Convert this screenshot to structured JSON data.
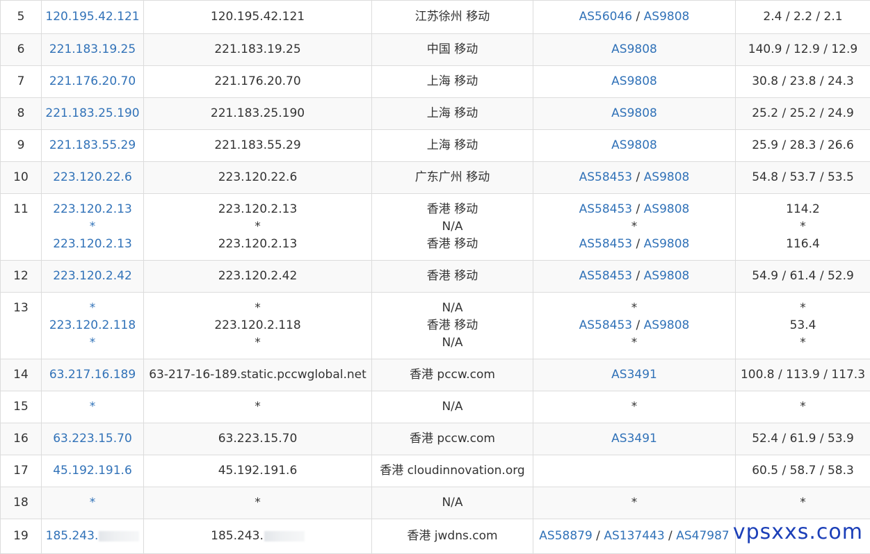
{
  "rows": [
    {
      "hop": "5",
      "ip": [
        "120.195.42.121"
      ],
      "host": [
        "120.195.42.121"
      ],
      "loc": [
        "江苏徐州 移动"
      ],
      "asn": [
        [
          "AS56046",
          "AS9808"
        ]
      ],
      "rtt": [
        "2.4 / 2.2 / 2.1"
      ]
    },
    {
      "hop": "6",
      "ip": [
        "221.183.19.25"
      ],
      "host": [
        "221.183.19.25"
      ],
      "loc": [
        "中国 移动"
      ],
      "asn": [
        [
          "AS9808"
        ]
      ],
      "rtt": [
        "140.9 / 12.9 / 12.9"
      ]
    },
    {
      "hop": "7",
      "ip": [
        "221.176.20.70"
      ],
      "host": [
        "221.176.20.70"
      ],
      "loc": [
        "上海 移动"
      ],
      "asn": [
        [
          "AS9808"
        ]
      ],
      "rtt": [
        "30.8 / 23.8 / 24.3"
      ]
    },
    {
      "hop": "8",
      "ip": [
        "221.183.25.190"
      ],
      "host": [
        "221.183.25.190"
      ],
      "loc": [
        "上海 移动"
      ],
      "asn": [
        [
          "AS9808"
        ]
      ],
      "rtt": [
        "25.2 / 25.2 / 24.9"
      ]
    },
    {
      "hop": "9",
      "ip": [
        "221.183.55.29"
      ],
      "host": [
        "221.183.55.29"
      ],
      "loc": [
        "上海 移动"
      ],
      "asn": [
        [
          "AS9808"
        ]
      ],
      "rtt": [
        "25.9 / 28.3 / 26.6"
      ]
    },
    {
      "hop": "10",
      "ip": [
        "223.120.22.6"
      ],
      "host": [
        "223.120.22.6"
      ],
      "loc": [
        "广东广州 移动"
      ],
      "asn": [
        [
          "AS58453",
          "AS9808"
        ]
      ],
      "rtt": [
        "54.8 / 53.7 / 53.5"
      ]
    },
    {
      "hop": "11",
      "ip": [
        "223.120.2.13",
        "*",
        "223.120.2.13"
      ],
      "host": [
        "223.120.2.13",
        "*",
        "223.120.2.13"
      ],
      "loc": [
        "香港 移动",
        "N/A",
        "香港 移动"
      ],
      "asn": [
        [
          "AS58453",
          "AS9808"
        ],
        [
          "*"
        ],
        [
          "AS58453",
          "AS9808"
        ]
      ],
      "rtt": [
        "114.2",
        "*",
        "116.4"
      ]
    },
    {
      "hop": "12",
      "ip": [
        "223.120.2.42"
      ],
      "host": [
        "223.120.2.42"
      ],
      "loc": [
        "香港 移动"
      ],
      "asn": [
        [
          "AS58453",
          "AS9808"
        ]
      ],
      "rtt": [
        "54.9 / 61.4 / 52.9"
      ]
    },
    {
      "hop": "13",
      "ip": [
        "*",
        "223.120.2.118",
        "*"
      ],
      "host": [
        "*",
        "223.120.2.118",
        "*"
      ],
      "loc": [
        "N/A",
        "香港 移动",
        "N/A"
      ],
      "asn": [
        [
          "*"
        ],
        [
          "AS58453",
          "AS9808"
        ],
        [
          "*"
        ]
      ],
      "rtt": [
        "*",
        "53.4",
        "*"
      ]
    },
    {
      "hop": "14",
      "ip": [
        "63.217.16.189"
      ],
      "host": [
        "63-217-16-189.static.pccwglobal.net"
      ],
      "loc": [
        "香港 pccw.com"
      ],
      "asn": [
        [
          "AS3491"
        ]
      ],
      "rtt": [
        "100.8 / 113.9 / 117.3"
      ]
    },
    {
      "hop": "15",
      "ip": [
        "*"
      ],
      "host": [
        "*"
      ],
      "loc": [
        "N/A"
      ],
      "asn": [
        [
          "*"
        ]
      ],
      "rtt": [
        "*"
      ]
    },
    {
      "hop": "16",
      "ip": [
        "63.223.15.70"
      ],
      "host": [
        "63.223.15.70"
      ],
      "loc": [
        "香港 pccw.com"
      ],
      "asn": [
        [
          "AS3491"
        ]
      ],
      "rtt": [
        "52.4 / 61.9 / 53.9"
      ]
    },
    {
      "hop": "17",
      "ip": [
        "45.192.191.6"
      ],
      "host": [
        "45.192.191.6"
      ],
      "loc": [
        "香港 cloudinnovation.org"
      ],
      "asn": [
        []
      ],
      "rtt": [
        "60.5 / 58.7 / 58.3"
      ]
    },
    {
      "hop": "18",
      "ip": [
        "*"
      ],
      "host": [
        "*"
      ],
      "loc": [
        "N/A"
      ],
      "asn": [
        [
          "*"
        ]
      ],
      "rtt": [
        "*"
      ]
    },
    {
      "hop": "19",
      "ip": [
        "185.243."
      ],
      "host": [
        "185.243."
      ],
      "loc": [
        "香港 jwdns.com"
      ],
      "asn": [
        [
          "AS58879",
          "AS137443",
          "AS47987"
        ]
      ],
      "rtt": [
        ""
      ],
      "redacted": true
    }
  ],
  "watermark": "vpsxxs.com",
  "colors": {
    "link": "#3172b8",
    "text": "#333333",
    "border": "#dcdcdc",
    "stripe": "#f9f9f9",
    "watermark": "#1b3fb8"
  }
}
